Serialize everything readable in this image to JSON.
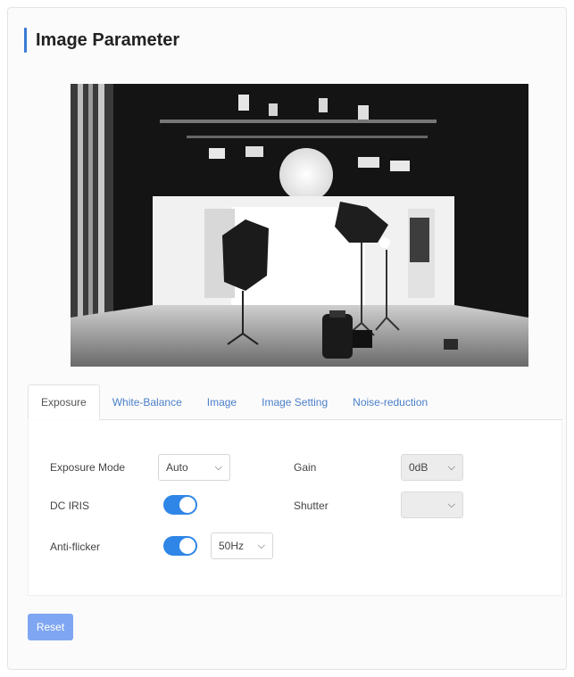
{
  "page": {
    "title": "Image Parameter"
  },
  "preview": {
    "icon": "studio-camera-preview"
  },
  "tabs": [
    {
      "label": "Exposure",
      "active": true
    },
    {
      "label": "White-Balance",
      "active": false
    },
    {
      "label": "Image",
      "active": false
    },
    {
      "label": "Image Setting",
      "active": false
    },
    {
      "label": "Noise-reduction",
      "active": false
    }
  ],
  "exposure": {
    "exposure_mode": {
      "label": "Exposure Mode",
      "value": "Auto"
    },
    "dc_iris": {
      "label": "DC IRIS",
      "on": true
    },
    "anti_flicker": {
      "label": "Anti-flicker",
      "on": true,
      "value": "50Hz"
    },
    "gain": {
      "label": "Gain",
      "value": "0dB"
    },
    "shutter": {
      "label": "Shutter",
      "value": ""
    }
  },
  "actions": {
    "reset_label": "Reset"
  },
  "colors": {
    "accent": "#3a7bd5",
    "toggle_on": "#2f86e6",
    "tab_link": "#4a7fc9",
    "reset_button": "#7ea6f2"
  }
}
